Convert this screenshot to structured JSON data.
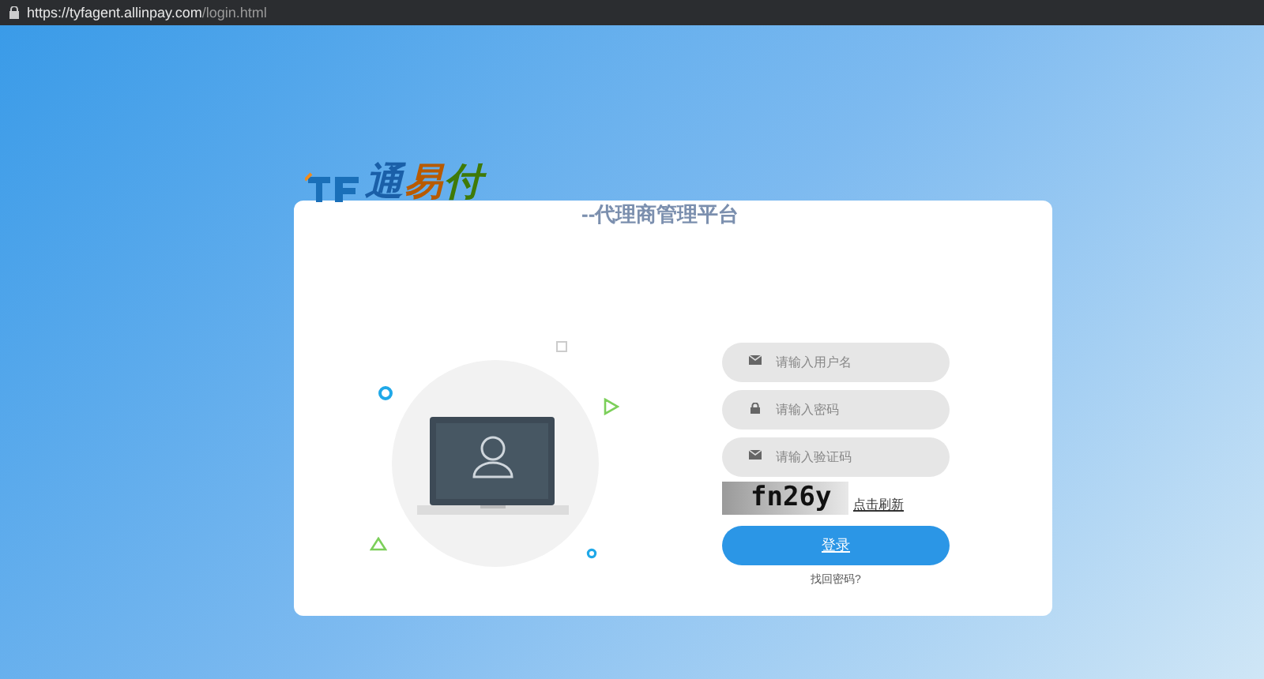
{
  "browser": {
    "url_host": "https://tyfagent.allinpay.com",
    "url_path": "/login.html"
  },
  "logo": {
    "text": "通易付"
  },
  "subtitle": "--代理商管理平台",
  "form": {
    "fields": [
      {
        "kind": "mail",
        "placeholder": "请输入用户名"
      },
      {
        "kind": "lock",
        "placeholder": "请输入密码"
      },
      {
        "kind": "mail",
        "placeholder": "请输入验证码"
      }
    ],
    "captcha": {
      "text": "fn26y",
      "refresh": "点击刷新"
    },
    "login_button": "登录",
    "forgot_link": "找回密码?"
  }
}
